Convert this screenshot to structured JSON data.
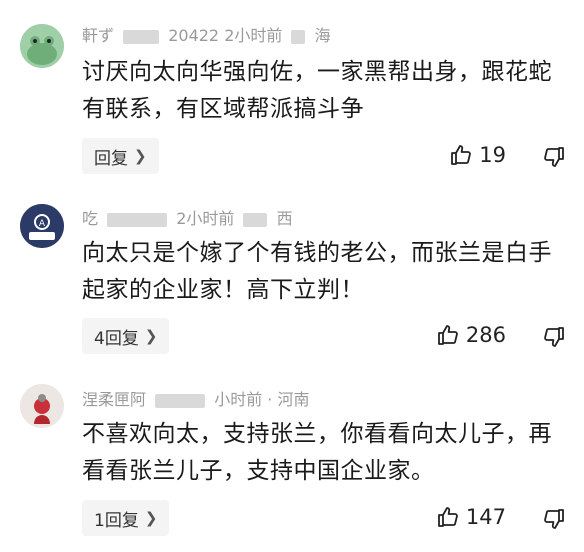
{
  "comments": [
    {
      "username": "軒ず",
      "meta_suffix": "20422 2小时前",
      "location": "海",
      "text": "讨厌向太向华强向佐，一家黑帮出身，跟花蛇有联系，有区域帮派搞斗争",
      "reply_label": "回复",
      "likes": "19",
      "avatar_color": "#8fc59a"
    },
    {
      "username": "吃",
      "meta_suffix": "2小时前",
      "location": "西",
      "text": "向太只是个嫁了个有钱的老公，而张兰是白手起家的企业家！高下立判！",
      "reply_label": "4回复",
      "likes": "286",
      "avatar_color": "#2b3a66"
    },
    {
      "username": "涅柔匣阿",
      "meta_suffix": "小时前 · 河南",
      "location": "",
      "text": "不喜欢向太，支持张兰，你看看向太儿子，再看看张兰儿子，支持中国企业家。",
      "reply_label": "1回复",
      "likes": "147",
      "avatar_color": "#e8e3df"
    }
  ]
}
